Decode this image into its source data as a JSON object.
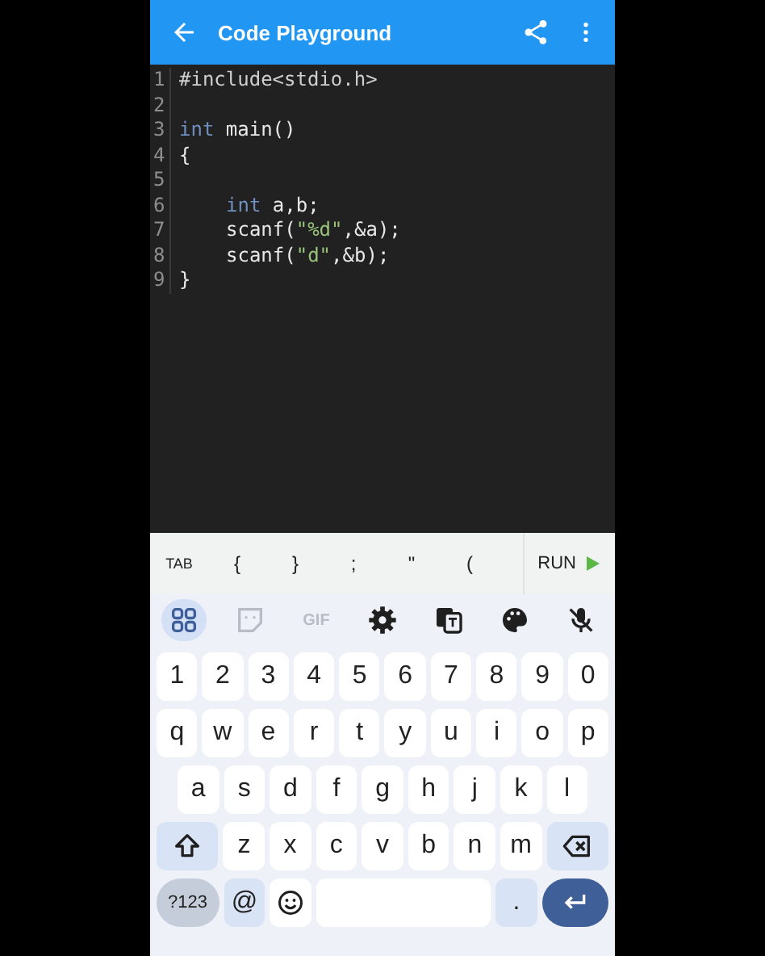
{
  "app_bar": {
    "title": "Code Playground"
  },
  "editor": {
    "lines": [
      {
        "number": "1",
        "indented": false,
        "tokens": [
          {
            "text": "#include<stdio.h>",
            "kind": "directive"
          }
        ]
      },
      {
        "number": "2"
      },
      {
        "number": "3",
        "indented": false,
        "tokens": [
          {
            "text": "int",
            "kind": "keyword"
          },
          {
            "text": " main()",
            "kind": "plain"
          }
        ]
      },
      {
        "number": "4",
        "indented": false,
        "tokens": [
          {
            "text": "{",
            "kind": "plain"
          }
        ]
      },
      {
        "number": "5"
      },
      {
        "number": "6",
        "indented": true,
        "tokens": [
          {
            "text": "int",
            "kind": "keyword"
          },
          {
            "text": " a,b;",
            "kind": "plain"
          }
        ]
      },
      {
        "number": "7",
        "indented": true,
        "tokens": [
          {
            "text": "scanf(",
            "kind": "plain"
          },
          {
            "text": "\"%d\"",
            "kind": "string"
          },
          {
            "text": ",&a);",
            "kind": "plain"
          }
        ]
      },
      {
        "number": "8",
        "indented": true,
        "tokens": [
          {
            "text": "scanf(",
            "kind": "plain"
          },
          {
            "text": "\"d\"",
            "kind": "string"
          },
          {
            "text": ",&b);",
            "kind": "plain"
          }
        ]
      },
      {
        "number": "9",
        "indented": false,
        "tokens": [
          {
            "text": "}",
            "kind": "plain"
          }
        ]
      }
    ]
  },
  "shortcut_bar": {
    "keys": [
      "TAB",
      "{",
      "}",
      ";",
      "\"",
      "("
    ],
    "run_button": "RUN"
  },
  "keyboard_toolbar": [
    {
      "kind": "apps",
      "selected": true,
      "disabled": false
    },
    {
      "kind": "sticker",
      "selected": false,
      "disabled": true
    },
    {
      "kind": "gif",
      "label": "GIF",
      "selected": false,
      "disabled": true
    },
    {
      "kind": "settings",
      "selected": false,
      "disabled": false
    },
    {
      "kind": "translate",
      "selected": false,
      "disabled": false
    },
    {
      "kind": "palette",
      "selected": false,
      "disabled": false
    },
    {
      "kind": "mic-off",
      "selected": false,
      "disabled": false
    }
  ],
  "keyboard_rows": [
    [
      {
        "kind": "char",
        "text": "1"
      },
      {
        "kind": "char",
        "text": "2"
      },
      {
        "kind": "char",
        "text": "3"
      },
      {
        "kind": "char",
        "text": "4"
      },
      {
        "kind": "char",
        "text": "5"
      },
      {
        "kind": "char",
        "text": "6"
      },
      {
        "kind": "char",
        "text": "7"
      },
      {
        "kind": "char",
        "text": "8"
      },
      {
        "kind": "char",
        "text": "9"
      },
      {
        "kind": "char",
        "text": "0"
      }
    ],
    [
      {
        "kind": "char",
        "text": "q"
      },
      {
        "kind": "char",
        "text": "w"
      },
      {
        "kind": "char",
        "text": "e"
      },
      {
        "kind": "char",
        "text": "r"
      },
      {
        "kind": "char",
        "text": "t"
      },
      {
        "kind": "char",
        "text": "y"
      },
      {
        "kind": "char",
        "text": "u"
      },
      {
        "kind": "char",
        "text": "i"
      },
      {
        "kind": "char",
        "text": "o"
      },
      {
        "kind": "char",
        "text": "p"
      }
    ],
    [
      {
        "kind": "char",
        "text": "a"
      },
      {
        "kind": "char",
        "text": "s"
      },
      {
        "kind": "char",
        "text": "d"
      },
      {
        "kind": "char",
        "text": "f"
      },
      {
        "kind": "char",
        "text": "g"
      },
      {
        "kind": "char",
        "text": "h"
      },
      {
        "kind": "char",
        "text": "j"
      },
      {
        "kind": "char",
        "text": "k"
      },
      {
        "kind": "char",
        "text": "l"
      }
    ],
    [
      {
        "kind": "shift"
      },
      {
        "kind": "char",
        "text": "z"
      },
      {
        "kind": "char",
        "text": "x"
      },
      {
        "kind": "char",
        "text": "c"
      },
      {
        "kind": "char",
        "text": "v"
      },
      {
        "kind": "char",
        "text": "b"
      },
      {
        "kind": "char",
        "text": "n"
      },
      {
        "kind": "char",
        "text": "m"
      },
      {
        "kind": "backspace"
      }
    ],
    [
      {
        "kind": "symbols",
        "text": "?123"
      },
      {
        "kind": "symbol",
        "text": "@"
      },
      {
        "kind": "emoji"
      },
      {
        "kind": "space"
      },
      {
        "kind": "symbol",
        "text": "."
      },
      {
        "kind": "enter"
      }
    ]
  ]
}
